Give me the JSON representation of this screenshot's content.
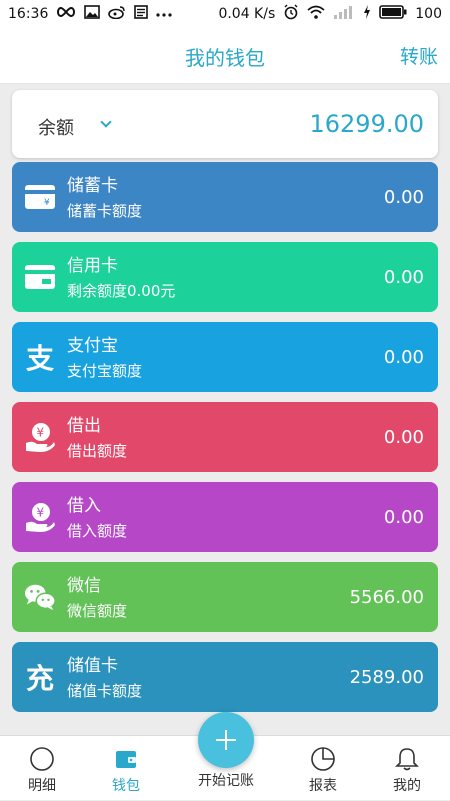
{
  "status_bar": {
    "time": "16:36",
    "speed": "0.04 K/s",
    "battery": "100"
  },
  "header": {
    "title": "我的钱包",
    "transfer": "转账"
  },
  "balance": {
    "label": "余额",
    "amount": "16299.00"
  },
  "accounts": [
    {
      "name": "储蓄卡",
      "sub": "储蓄卡额度",
      "amount": "0.00",
      "color": "#3d86c6",
      "icon": "debit-card-icon"
    },
    {
      "name": "信用卡",
      "sub": "剩余额度0.00元",
      "amount": "0.00",
      "color": "#1dd19a",
      "icon": "credit-card-icon"
    },
    {
      "name": "支付宝",
      "sub": "支付宝额度",
      "amount": "0.00",
      "color": "#18a3e0",
      "icon": "alipay-icon"
    },
    {
      "name": "借出",
      "sub": "借出额度",
      "amount": "0.00",
      "color": "#e2486a",
      "icon": "lend-out-icon"
    },
    {
      "name": "借入",
      "sub": "借入额度",
      "amount": "0.00",
      "color": "#b648c8",
      "icon": "borrow-in-icon"
    },
    {
      "name": "微信",
      "sub": "微信额度",
      "amount": "5566.00",
      "color": "#62c258",
      "icon": "wechat-icon"
    },
    {
      "name": "储值卡",
      "sub": "储值卡额度",
      "amount": "2589.00",
      "color": "#2a92bc",
      "icon": "prepaid-card-icon"
    }
  ],
  "bottom_nav": {
    "details": "明细",
    "wallet": "钱包",
    "start_record": "开始记账",
    "reports": "报表",
    "mine": "我的"
  },
  "colors": {
    "accent": "#2aa8cc",
    "fab": "#49c0dd"
  }
}
